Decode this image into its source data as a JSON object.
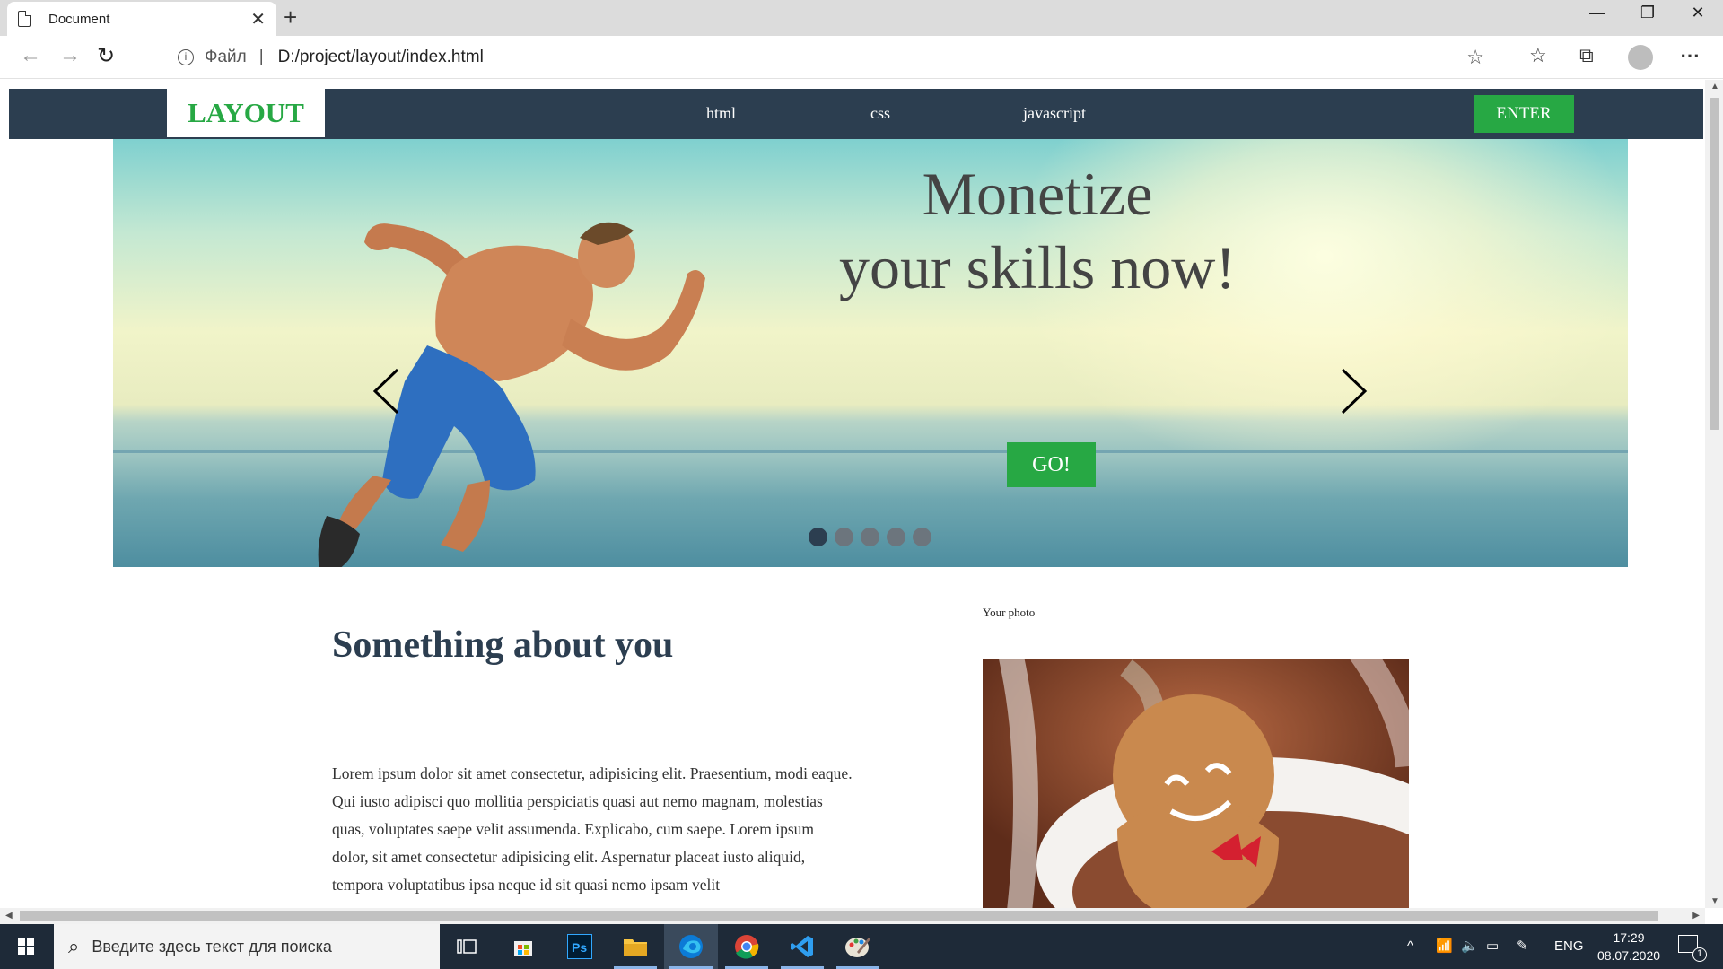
{
  "browser": {
    "tab_title": "Document",
    "tab_close": "✕",
    "new_tab": "+",
    "window_controls": {
      "minimize": "—",
      "maximize": "❐",
      "close": "✕"
    },
    "address": {
      "protocol_label": "Файл",
      "separator": "|",
      "url": "D:/project/layout/index.html"
    },
    "icons": [
      "back-icon",
      "forward-icon",
      "refresh-icon",
      "info-icon",
      "favorite-star-icon",
      "favorites-list-icon",
      "collections-icon",
      "profile-avatar-icon",
      "more-menu-icon"
    ]
  },
  "site": {
    "logo": "LAYOUT",
    "menu": [
      "html",
      "css",
      "javascript"
    ],
    "enter_label": "ENTER",
    "slider": {
      "headline_line1": "Monetize",
      "headline_line2": "your skills now!",
      "go_label": "GO!",
      "slide_count": 5,
      "active_slide": 1
    },
    "about": {
      "title": "Something about you",
      "text": "Lorem ipsum dolor sit amet consectetur, adipisicing elit. Praesentium, modi eaque. Qui iusto adipisci quo mollitia perspiciatis quasi aut nemo magnam, molestias quas, voluptates saepe velit assumenda. Explicabo, cum saepe. Lorem ipsum dolor, sit amet consectetur adipisicing elit. Aspernatur placeat iusto aliquid, tempora voluptatibus ipsa neque id sit quasi nemo ipsam velit"
    },
    "photo_label": "Your photo"
  },
  "taskbar": {
    "search_placeholder": "Введите здесь текст для поиска",
    "apps": [
      "task-view",
      "store",
      "photoshop",
      "file-explorer",
      "edge",
      "chrome",
      "vscode",
      "paint"
    ],
    "active_app": "edge",
    "language": "ENG",
    "time": "17:29",
    "date": "08.07.2020",
    "notification_count": "1"
  },
  "colors": {
    "header_bg": "#2c3e50",
    "accent_green": "#27a844",
    "dot_inactive": "#6c757d",
    "dot_active": "#2c3e50",
    "taskbar_bg": "#1e2a38"
  }
}
